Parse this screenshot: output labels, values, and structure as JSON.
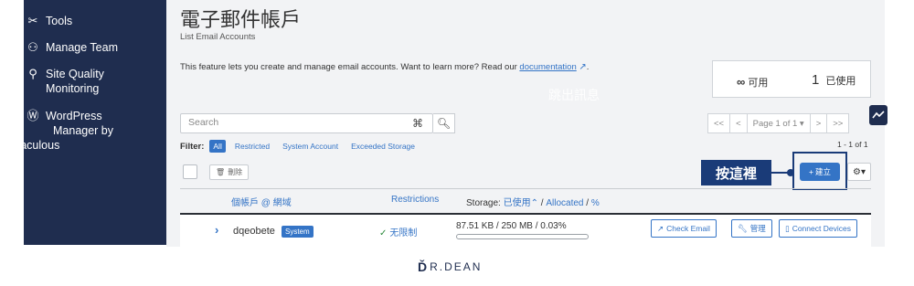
{
  "sidebar": {
    "items": [
      {
        "icon": "tools-icon",
        "label": "Tools"
      },
      {
        "icon": "manage-team-icon",
        "label": "Manage Team"
      },
      {
        "icon": "site-quality-icon",
        "label": "Site Quality",
        "label2": "Monitoring"
      },
      {
        "icon": "wordpress-icon",
        "label": "WordPress",
        "label2": "Manager by"
      }
    ],
    "extra": "Softaculous"
  },
  "page": {
    "title": "電子郵件帳戶",
    "subtitle": "List Email Accounts",
    "intro_text": "This feature lets you create and manage email accounts. Want to learn more? Read our",
    "intro_link": "documentation",
    "intro_end": "."
  },
  "stats": {
    "unlimited_symbol": "∞",
    "unlimited_label": "可用",
    "used_count": "1",
    "used_label": "已使用"
  },
  "watermark": "跳出訊息",
  "search": {
    "placeholder": "Search"
  },
  "pagination": {
    "first": "<<",
    "prev": "<",
    "page": "Page 1 of 1 ▾",
    "next": ">",
    "last": ">>",
    "count": "1 - 1 of 1"
  },
  "filter": {
    "label": "Filter:",
    "all": "All",
    "options": [
      "Restricted",
      "System Account",
      "Exceeded Storage"
    ]
  },
  "toolbar": {
    "delete_label": "刪除",
    "create_label": "建立",
    "gear": "⚙▾"
  },
  "callout": "按這裡",
  "table": {
    "headers": {
      "account": "個帳戶 @ 網域",
      "restrictions": "Restrictions",
      "storage_prefix": "Storage:",
      "storage_used": "已使用",
      "storage_sep1": "/",
      "storage_allocated": "Allocated",
      "storage_sep2": "/",
      "storage_pct": "%"
    },
    "rows": [
      {
        "account": "dqeobete",
        "badge": "System",
        "restriction": "无限制",
        "usage": "87.51 KB / 250 MB / 0.03%",
        "usage_fraction": 0.0003,
        "actions": [
          "Check Email",
          "管理",
          "Connect Devices"
        ]
      }
    ]
  },
  "brand": "R.DEAN",
  "colors": {
    "sidebar_bg": "#1f2d4f",
    "accent": "#3474c6",
    "callout": "#1a3b78",
    "ok_green": "#2e8b3e"
  }
}
